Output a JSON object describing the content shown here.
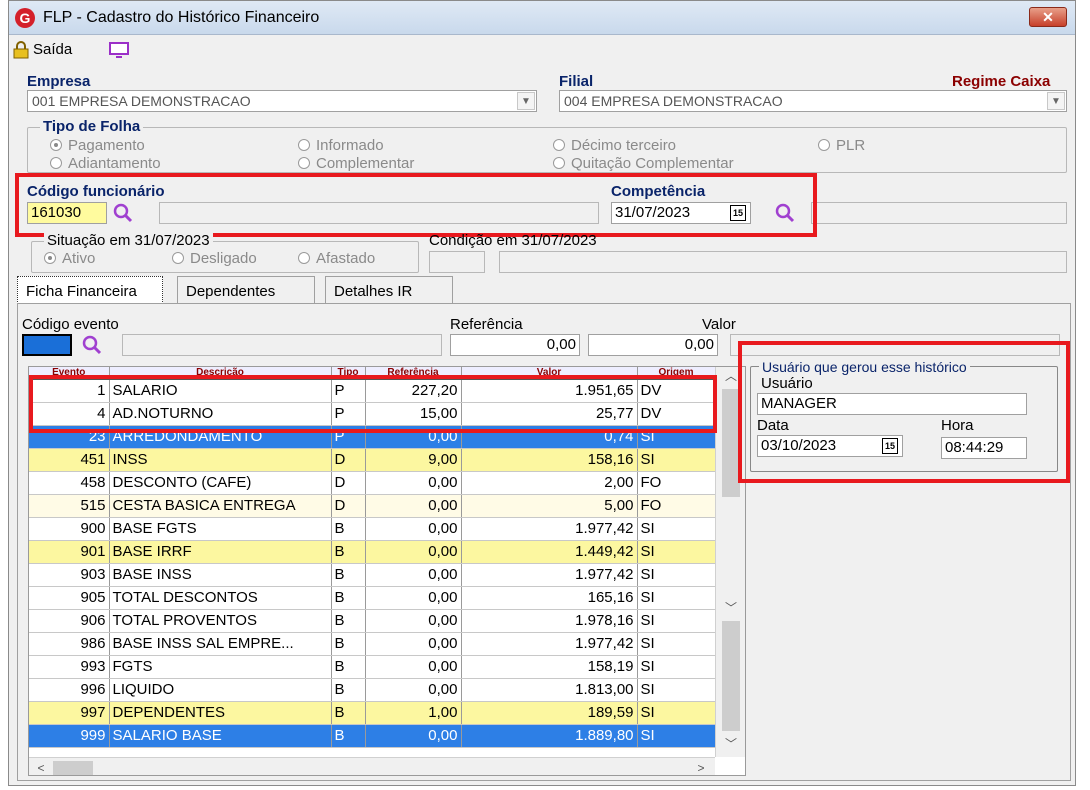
{
  "window": {
    "title": "FLP - Cadastro do Histórico Financeiro",
    "close": "✕"
  },
  "toolbar": {
    "exit_label": "Saída"
  },
  "empresa": {
    "label": "Empresa",
    "value": "001 EMPRESA DEMONSTRACAO"
  },
  "filial": {
    "label": "Filial",
    "value": "004 EMPRESA DEMONSTRACAO"
  },
  "regime": "Regime Caixa",
  "tipo_folha": {
    "title": "Tipo de Folha",
    "options": [
      "Pagamento",
      "Informado",
      "Décimo terceiro",
      "PLR",
      "Adiantamento",
      "Complementar",
      "Quitação Complementar"
    ],
    "selected": "Pagamento"
  },
  "codigo": {
    "label": "Código funcionário",
    "value": "161030",
    "name": ""
  },
  "competencia": {
    "label": "Competência",
    "value": "31/07/2023",
    "cal": "15"
  },
  "situacao": {
    "title": "Situação em  31/07/2023",
    "options": [
      "Ativo",
      "Desligado",
      "Afastado"
    ],
    "selected": "Ativo"
  },
  "condicao": {
    "title": "Condição em 31/07/2023"
  },
  "tabs": [
    "Ficha Financeira",
    "Dependentes",
    "Detalhes IR"
  ],
  "evento_form": {
    "codigo_label": "Código evento",
    "referencia_label": "Referência",
    "referencia_value": "0,00",
    "valor_label": "Valor",
    "valor_value": "0,00"
  },
  "grid": {
    "headers": [
      "Evento",
      "Descrição",
      "Tipo",
      "Referência",
      "Valor",
      "Origem"
    ],
    "rows": [
      {
        "evento": "1",
        "descricao": "SALARIO",
        "tipo": "P",
        "referencia": "227,20",
        "valor": "1.951,65",
        "origem": "DV",
        "style": "white"
      },
      {
        "evento": "4",
        "descricao": "AD.NOTURNO",
        "tipo": "P",
        "referencia": "15,00",
        "valor": "25,77",
        "origem": "DV",
        "style": "white"
      },
      {
        "evento": "23",
        "descricao": "ARREDONDAMENTO",
        "tipo": "P",
        "referencia": "0,00",
        "valor": "0,74",
        "origem": "SI",
        "style": "blue"
      },
      {
        "evento": "451",
        "descricao": "INSS",
        "tipo": "D",
        "referencia": "9,00",
        "valor": "158,16",
        "origem": "SI",
        "style": "yellow"
      },
      {
        "evento": "458",
        "descricao": "DESCONTO (CAFE)",
        "tipo": "D",
        "referencia": "0,00",
        "valor": "2,00",
        "origem": "FO",
        "style": "white"
      },
      {
        "evento": "515",
        "descricao": "CESTA BASICA ENTREGA",
        "tipo": "D",
        "referencia": "0,00",
        "valor": "5,00",
        "origem": "FO",
        "style": "cream"
      },
      {
        "evento": "900",
        "descricao": "BASE FGTS",
        "tipo": "B",
        "referencia": "0,00",
        "valor": "1.977,42",
        "origem": "SI",
        "style": "white"
      },
      {
        "evento": "901",
        "descricao": "BASE IRRF",
        "tipo": "B",
        "referencia": "0,00",
        "valor": "1.449,42",
        "origem": "SI",
        "style": "yellow"
      },
      {
        "evento": "903",
        "descricao": "BASE INSS",
        "tipo": "B",
        "referencia": "0,00",
        "valor": "1.977,42",
        "origem": "SI",
        "style": "white"
      },
      {
        "evento": "905",
        "descricao": "TOTAL DESCONTOS",
        "tipo": "B",
        "referencia": "0,00",
        "valor": "165,16",
        "origem": "SI",
        "style": "white"
      },
      {
        "evento": "906",
        "descricao": "TOTAL PROVENTOS",
        "tipo": "B",
        "referencia": "0,00",
        "valor": "1.978,16",
        "origem": "SI",
        "style": "white"
      },
      {
        "evento": "986",
        "descricao": "BASE INSS SAL EMPRE...",
        "tipo": "B",
        "referencia": "0,00",
        "valor": "1.977,42",
        "origem": "SI",
        "style": "white"
      },
      {
        "evento": "993",
        "descricao": "FGTS",
        "tipo": "B",
        "referencia": "0,00",
        "valor": "158,19",
        "origem": "SI",
        "style": "white"
      },
      {
        "evento": "996",
        "descricao": "LIQUIDO",
        "tipo": "B",
        "referencia": "0,00",
        "valor": "1.813,00",
        "origem": "SI",
        "style": "white"
      },
      {
        "evento": "997",
        "descricao": "DEPENDENTES",
        "tipo": "B",
        "referencia": "1,00",
        "valor": "189,59",
        "origem": "SI",
        "style": "yellow"
      },
      {
        "evento": "999",
        "descricao": "SALARIO BASE",
        "tipo": "B",
        "referencia": "0,00",
        "valor": "1.889,80",
        "origem": "SI",
        "style": "blue"
      }
    ]
  },
  "usuario_group": {
    "title": "Usuário que gerou esse histórico",
    "usuario_label": "Usuário",
    "usuario_value": "MANAGER",
    "data_label": "Data",
    "data_value": "03/10/2023",
    "data_cal": "15",
    "hora_label": "Hora",
    "hora_value": "08:44:29"
  },
  "colors": {
    "highlight_red": "#e8191e",
    "row_blue": "#2d7fe6",
    "row_yellow": "#fcf7a0",
    "label_blue": "#0a246a",
    "regime_red": "#8b0000"
  }
}
